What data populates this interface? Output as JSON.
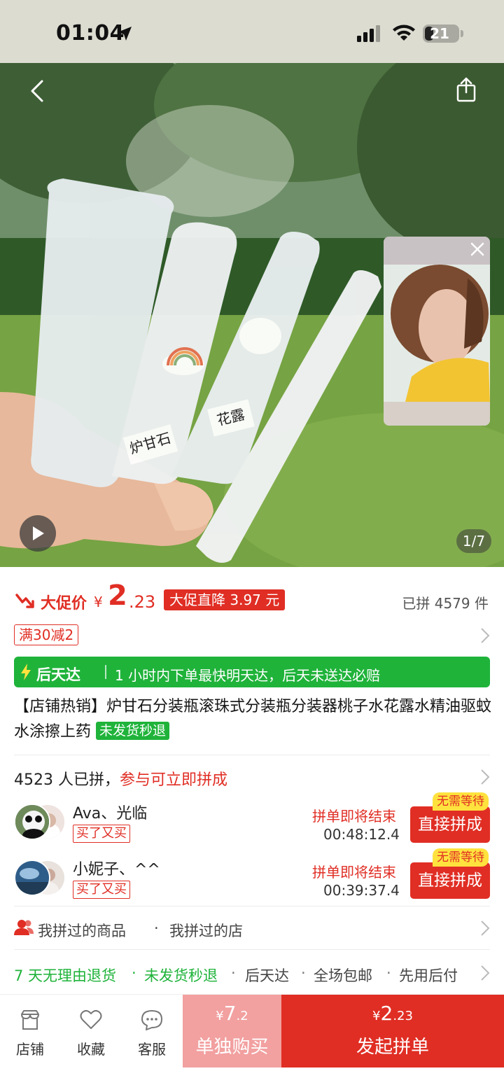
{
  "status_bar": {
    "time": "01:04",
    "battery": "21"
  },
  "hero": {
    "page_indicator": "1/7",
    "label_left": "炉甘石",
    "label_right": "花露"
  },
  "price": {
    "promo_label": "大促价",
    "currency": "¥",
    "integer": "2",
    "decimal": ".23",
    "promo_badge": "大促直降 3.97 元",
    "sold": "已拼 4579 件"
  },
  "coupon": "满30减2",
  "delivery": {
    "title": "后天达",
    "desc": "1 小时内下单最快明天达，后天未送达必赔"
  },
  "product": {
    "title": "【店铺热销】炉甘石分装瓶滚珠式分装瓶分装器桃子水花露水精油驱蚊水涂擦上药",
    "badge": "未发货秒退"
  },
  "group": {
    "count_text": "4523 人已拼，",
    "cta_text": "参与可立即拼成",
    "rows": [
      {
        "names": "Ava、光临",
        "tag": "买了又买",
        "ending": "拼单即将结束",
        "countdown": "00:48:12.4",
        "button": "直接拼成",
        "badge": "无需等待"
      },
      {
        "names": "小妮子、^^",
        "tag": "买了又买",
        "ending": "拼单即将结束",
        "countdown": "00:39:37.4",
        "button": "直接拼成",
        "badge": "无需等待"
      }
    ]
  },
  "history": {
    "items": [
      "我拼过的商品",
      "·",
      "我拼过的店"
    ]
  },
  "services": [
    "7 天无理由退货",
    "·",
    "未发货秒退",
    "·",
    "后天达",
    "·",
    "全场包邮",
    "·",
    "先用后付"
  ],
  "bottom_bar": {
    "nav": [
      {
        "label": "店铺",
        "icon": "store-icon"
      },
      {
        "label": "收藏",
        "icon": "heart-icon"
      },
      {
        "label": "客服",
        "icon": "chat-icon"
      }
    ],
    "single": {
      "currency": "¥",
      "integer": "7",
      "decimal": ".2",
      "label": "单独购买"
    },
    "group": {
      "currency": "¥",
      "integer": "2",
      "decimal": ".23",
      "label": "发起拼单"
    }
  },
  "colors": {
    "brand_red": "#e02e24",
    "delivery_green": "#1fb33a",
    "single_buy_pink": "#f2a0a0"
  }
}
